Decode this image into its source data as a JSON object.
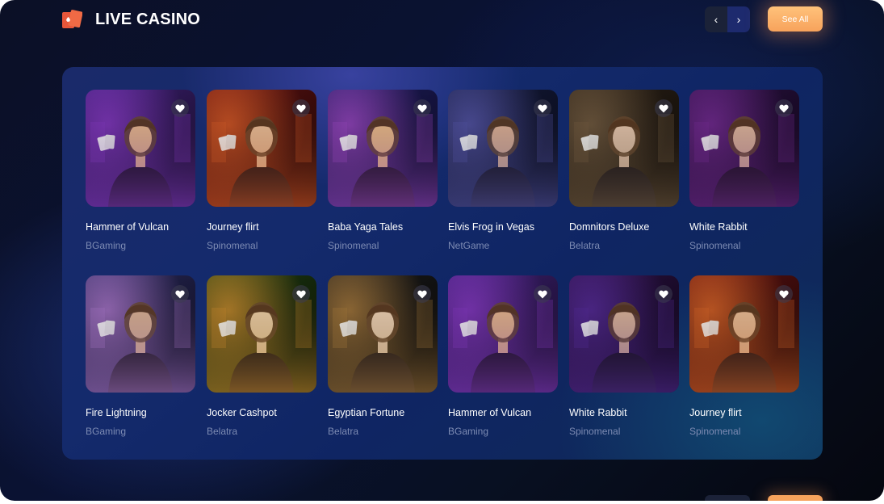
{
  "header": {
    "title": "LIVE CASINO",
    "logo_icon": "playing-cards-icon",
    "prev_icon": "chevron-left-icon",
    "next_icon": "chevron-right-icon",
    "prev_symbol": "‹",
    "next_symbol": "›",
    "see_all_label": "See All"
  },
  "games": [
    {
      "title": "Hammer of Vulcan",
      "provider": "BGaming"
    },
    {
      "title": "Journey flirt",
      "provider": "Spinomenal"
    },
    {
      "title": "Baba Yaga Tales",
      "provider": "Spinomenal"
    },
    {
      "title": "Elvis Frog in Vegas",
      "provider": "NetGame"
    },
    {
      "title": "Domnitors Deluxe",
      "provider": "Belatra"
    },
    {
      "title": "White Rabbit",
      "provider": "Spinomenal"
    },
    {
      "title": "Fire Lightning",
      "provider": "BGaming"
    },
    {
      "title": "Jocker Cashpot",
      "provider": "Belatra"
    },
    {
      "title": "Egyptian Fortune",
      "provider": "Belatra"
    },
    {
      "title": "Hammer of Vulcan",
      "provider": "BGaming"
    },
    {
      "title": "White Rabbit",
      "provider": "Spinomenal"
    },
    {
      "title": "Journey flirt",
      "provider": "Spinomenal"
    }
  ],
  "colors": {
    "accent": "#f7a35c",
    "nav_next_bg": "#1d2a6e",
    "provider_text": "#7d8bb3",
    "thumb_themes": [
      [
        "#3a1d6e",
        "#8a3cc8",
        "#f0c090",
        "#1a0f2e"
      ],
      [
        "#5a1010",
        "#e0602a",
        "#f2c7a0",
        "#200606"
      ],
      [
        "#1b1a55",
        "#a04ac8",
        "#f3c48a",
        "#0e0c2a"
      ],
      [
        "#141a3a",
        "#5a5ab0",
        "#e8b898",
        "#080a18"
      ],
      [
        "#2a2016",
        "#7a6246",
        "#f0cfb6",
        "#0f0b08"
      ],
      [
        "#2a1040",
        "#7a2e9a",
        "#e8c0a0",
        "#0e0618"
      ],
      [
        "#2b2a5a",
        "#b07ad0",
        "#e2b896",
        "#0c0c20"
      ],
      [
        "#1e3a10",
        "#d09030",
        "#f6d8b0",
        "#0a1406"
      ],
      [
        "#1a1a1a",
        "#b08040",
        "#f8dcc0",
        "#080808"
      ],
      [
        "#3a1d6e",
        "#8a3cc8",
        "#f0c090",
        "#1a0f2e"
      ],
      [
        "#2a1040",
        "#5a2ea0",
        "#e8c0a0",
        "#0e0618"
      ],
      [
        "#5a1010",
        "#e06a2a",
        "#f2c7a0",
        "#200606"
      ]
    ]
  }
}
